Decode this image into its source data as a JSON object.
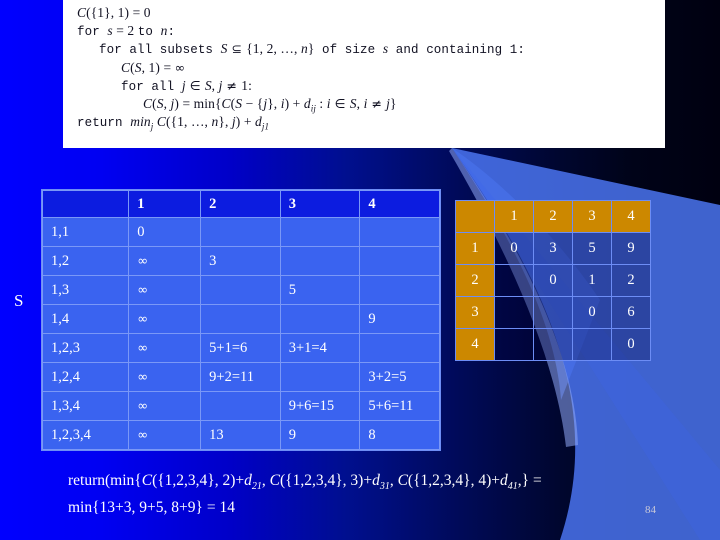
{
  "slide": {
    "number": "84",
    "left_margin_label": "S"
  },
  "pseudocode": {
    "lines": [
      {
        "indent": 0,
        "parts": [
          {
            "t": "math",
            "v": "C"
          },
          {
            "t": "rm",
            "v": "({1}, 1) = 0"
          }
        ]
      },
      {
        "indent": 0,
        "parts": [
          {
            "t": "mono",
            "v": "for "
          },
          {
            "t": "math",
            "v": "s"
          },
          {
            "t": "rm",
            "v": " = 2 "
          },
          {
            "t": "mono",
            "v": "to "
          },
          {
            "t": "math",
            "v": "n"
          },
          {
            "t": "mono",
            "v": ":"
          }
        ]
      },
      {
        "indent": 1,
        "parts": [
          {
            "t": "mono",
            "v": "for all subsets "
          },
          {
            "t": "math",
            "v": "S"
          },
          {
            "t": "sym",
            "v": " ⊆ "
          },
          {
            "t": "rm",
            "v": "{1, 2, …, "
          },
          {
            "t": "math",
            "v": "n"
          },
          {
            "t": "rm",
            "v": "}"
          },
          {
            "t": "mono",
            "v": " of size "
          },
          {
            "t": "math",
            "v": "s"
          },
          {
            "t": "mono",
            "v": " and containing 1:"
          }
        ]
      },
      {
        "indent": 2,
        "parts": [
          {
            "t": "math",
            "v": "C"
          },
          {
            "t": "rm",
            "v": "("
          },
          {
            "t": "math",
            "v": "S"
          },
          {
            "t": "rm",
            "v": ", 1) = "
          },
          {
            "t": "sym",
            "v": "∞"
          }
        ]
      },
      {
        "indent": 2,
        "parts": [
          {
            "t": "mono",
            "v": "for all "
          },
          {
            "t": "math",
            "v": "j"
          },
          {
            "t": "sym",
            "v": " ∈ "
          },
          {
            "t": "math",
            "v": "S"
          },
          {
            "t": "rm",
            "v": ", "
          },
          {
            "t": "math",
            "v": "j"
          },
          {
            "t": "sym",
            "v": " ≠ "
          },
          {
            "t": "rm",
            "v": "1:"
          }
        ]
      },
      {
        "indent": 3,
        "parts": [
          {
            "t": "math",
            "v": "C"
          },
          {
            "t": "rm",
            "v": "("
          },
          {
            "t": "math",
            "v": "S"
          },
          {
            "t": "rm",
            "v": ", "
          },
          {
            "t": "math",
            "v": "j"
          },
          {
            "t": "rm",
            "v": ") = min{"
          },
          {
            "t": "math",
            "v": "C"
          },
          {
            "t": "rm",
            "v": "("
          },
          {
            "t": "math",
            "v": "S"
          },
          {
            "t": "rm",
            "v": " − {"
          },
          {
            "t": "math",
            "v": "j"
          },
          {
            "t": "rm",
            "v": "}, "
          },
          {
            "t": "math",
            "v": "i"
          },
          {
            "t": "rm",
            "v": ") + "
          },
          {
            "t": "mathsub",
            "v": "d",
            "sub": "ij"
          },
          {
            "t": "rm",
            "v": " : "
          },
          {
            "t": "math",
            "v": "i"
          },
          {
            "t": "sym",
            "v": " ∈ "
          },
          {
            "t": "math",
            "v": "S"
          },
          {
            "t": "rm",
            "v": ", "
          },
          {
            "t": "math",
            "v": "i"
          },
          {
            "t": "sym",
            "v": " ≠ "
          },
          {
            "t": "math",
            "v": "j"
          },
          {
            "t": "rm",
            "v": "}"
          }
        ]
      },
      {
        "indent": 0,
        "parts": [
          {
            "t": "mono",
            "v": "return "
          },
          {
            "t": "mathsub",
            "v": "min",
            "sub": "j"
          },
          {
            "t": "rm",
            "v": " "
          },
          {
            "t": "math",
            "v": "C"
          },
          {
            "t": "rm",
            "v": "({1, …, "
          },
          {
            "t": "math",
            "v": "n"
          },
          {
            "t": "rm",
            "v": "}, "
          },
          {
            "t": "math",
            "v": "j"
          },
          {
            "t": "rm",
            "v": ") + "
          },
          {
            "t": "mathsub",
            "v": "d",
            "sub": "j1"
          }
        ]
      }
    ]
  },
  "dp_table": {
    "columns": [
      "",
      "1",
      "2",
      "3",
      "4"
    ],
    "rows": [
      {
        "label": "1,1",
        "cells": [
          "0",
          "",
          "",
          ""
        ]
      },
      {
        "label": "1,2",
        "cells": [
          "∞",
          "3",
          "",
          ""
        ]
      },
      {
        "label": "1,3",
        "cells": [
          "∞",
          "",
          "5",
          ""
        ]
      },
      {
        "label": "1,4",
        "cells": [
          "∞",
          "",
          "",
          "9"
        ]
      },
      {
        "label": "1,2,3",
        "cells": [
          "∞",
          "5+1=6",
          "3+1=4",
          ""
        ]
      },
      {
        "label": "1,2,4",
        "cells": [
          "∞",
          "9+2=11",
          "",
          "3+2=5"
        ]
      },
      {
        "label": "1,3,4",
        "cells": [
          "∞",
          "",
          "9+6=15",
          "5+6=11"
        ]
      },
      {
        "label": "1,2,3,4",
        "cells": [
          "∞",
          "13",
          "9",
          "8"
        ]
      }
    ]
  },
  "dist_matrix": {
    "columns": [
      "",
      "1",
      "2",
      "3",
      "4"
    ],
    "rows": [
      {
        "label": "1",
        "cells": [
          "0",
          "3",
          "5",
          "9"
        ]
      },
      {
        "label": "2",
        "cells": [
          "",
          "0",
          "1",
          "2"
        ]
      },
      {
        "label": "3",
        "cells": [
          "",
          "",
          "0",
          "6"
        ]
      },
      {
        "label": "4",
        "cells": [
          "",
          "",
          "",
          "0"
        ]
      }
    ],
    "header_color": "#cc8800"
  },
  "return_text": {
    "line1_parts": [
      {
        "t": "rm",
        "v": "return(min{"
      },
      {
        "t": "it",
        "v": "C"
      },
      {
        "t": "rm",
        "v": "({1,2,3,4}, 2)+"
      },
      {
        "t": "sub",
        "v": "d",
        "sub": "21"
      },
      {
        "t": "rm",
        "v": ", "
      },
      {
        "t": "it",
        "v": "C"
      },
      {
        "t": "rm",
        "v": "({1,2,3,4}, 3)+"
      },
      {
        "t": "sub",
        "v": "d",
        "sub": "31"
      },
      {
        "t": "rm",
        "v": ", "
      },
      {
        "t": "it",
        "v": "C"
      },
      {
        "t": "rm",
        "v": "({1,2,3,4}, 4)+"
      },
      {
        "t": "sub",
        "v": "d",
        "sub": "41"
      },
      {
        "t": "rm",
        "v": ",} ="
      }
    ],
    "line2": "min{13+3, 9+5, 8+9} = 14"
  },
  "colors": {
    "background_left": "#0000ff",
    "background_right": "#000010",
    "dp_header": "#0c1ce0",
    "dp_body": "#3a63f0",
    "matrix_header": "#cc8800",
    "swoosh": "#4a74f0",
    "code_panel": "#ffffff"
  }
}
